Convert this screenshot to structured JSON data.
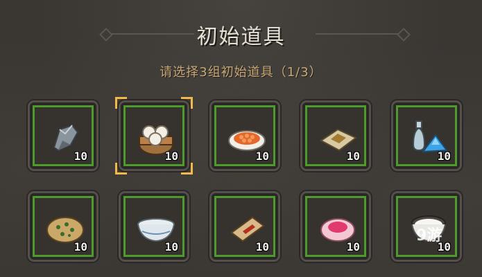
{
  "title": "初始道具",
  "subtitle": "请选择3组初始道具（1/3）",
  "selected_index": 1,
  "items": [
    {
      "icon": "stone-icon",
      "qty": "10"
    },
    {
      "icon": "steamed-buns-icon",
      "qty": "10"
    },
    {
      "icon": "fish-roe-plate-icon",
      "qty": "10"
    },
    {
      "icon": "powder-paper-icon",
      "qty": "10"
    },
    {
      "icon": "potion-bottle-crystal-icon",
      "qty": "10"
    },
    {
      "icon": "vegetable-pancake-icon",
      "qty": "10"
    },
    {
      "icon": "porcelain-bowl-icon",
      "qty": "10"
    },
    {
      "icon": "red-seal-box-icon",
      "qty": "10"
    },
    {
      "icon": "pink-dessert-icon",
      "qty": "10"
    },
    {
      "icon": "rice-bowl-icon",
      "qty": "10"
    }
  ],
  "watermark": "9游"
}
